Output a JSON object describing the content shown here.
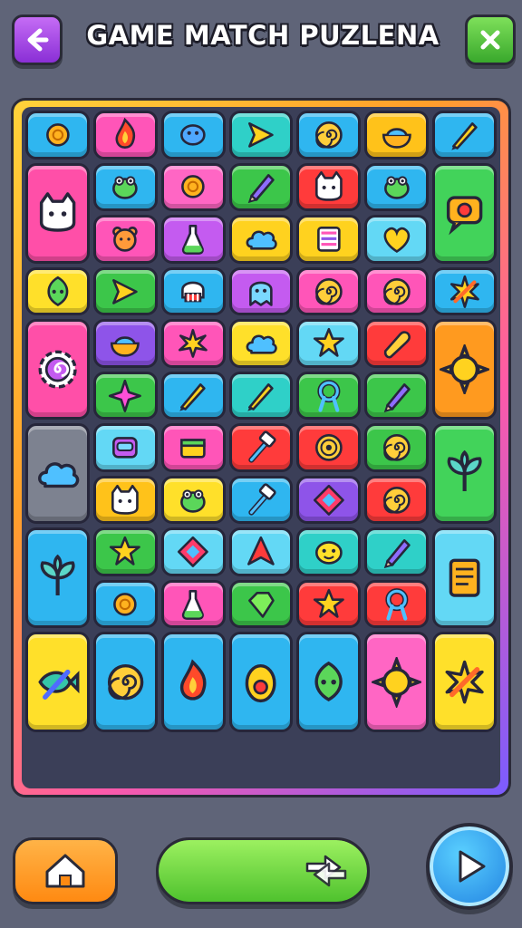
{
  "header": {
    "title": "GAME MATCH PUZLENA",
    "back_icon": "arrow-left-icon",
    "close_icon": "close-x-icon"
  },
  "board": {
    "columns": 7,
    "rows": 13,
    "tiles": [
      {
        "icon": "sun-blob",
        "color": "#2fb6f0",
        "row": 0,
        "col": 0,
        "rowspan": 1,
        "colspan": 1
      },
      {
        "icon": "flame",
        "color": "#ff55b8",
        "row": 0,
        "col": 1,
        "rowspan": 1,
        "colspan": 1
      },
      {
        "icon": "bird",
        "color": "#2fb6f0",
        "row": 0,
        "col": 2,
        "rowspan": 1,
        "colspan": 1
      },
      {
        "icon": "arrow",
        "color": "#2fd0c8",
        "row": 0,
        "col": 3,
        "rowspan": 1,
        "colspan": 1
      },
      {
        "icon": "spiral",
        "color": "#2fb6f0",
        "row": 0,
        "col": 4,
        "rowspan": 1,
        "colspan": 1
      },
      {
        "icon": "bowl",
        "color": "#ffc21a",
        "row": 0,
        "col": 5,
        "rowspan": 1,
        "colspan": 1
      },
      {
        "icon": "pen-star",
        "color": "#2fb6f0",
        "row": 0,
        "col": 6,
        "rowspan": 1,
        "colspan": 1
      },
      {
        "icon": "cat-face",
        "color": "#ff4fa8",
        "row": 1,
        "col": 0,
        "rowspan": 2,
        "colspan": 1
      },
      {
        "icon": "frog",
        "color": "#2fb6f0",
        "row": 1,
        "col": 1,
        "rowspan": 1,
        "colspan": 1
      },
      {
        "icon": "sun-blob",
        "color": "#ff66c4",
        "row": 1,
        "col": 2,
        "rowspan": 1,
        "colspan": 1
      },
      {
        "icon": "pencil",
        "color": "#3cc64a",
        "row": 1,
        "col": 3,
        "rowspan": 1,
        "colspan": 1
      },
      {
        "icon": "cat-face",
        "color": "#ff3b3b",
        "row": 1,
        "col": 4,
        "rowspan": 1,
        "colspan": 1
      },
      {
        "icon": "frog",
        "color": "#2fb6f0",
        "row": 1,
        "col": 5,
        "rowspan": 1,
        "colspan": 1
      },
      {
        "icon": "chat-target",
        "color": "#42d35a",
        "row": 1,
        "col": 6,
        "rowspan": 2,
        "colspan": 1
      },
      {
        "icon": "bear",
        "color": "#ff55b8",
        "row": 2,
        "col": 1,
        "rowspan": 1,
        "colspan": 1
      },
      {
        "icon": "potion",
        "color": "#c45bf0",
        "row": 2,
        "col": 2,
        "rowspan": 1,
        "colspan": 1
      },
      {
        "icon": "cloud",
        "color": "#ffd21f",
        "row": 2,
        "col": 3,
        "rowspan": 1,
        "colspan": 1
      },
      {
        "icon": "stripes",
        "color": "#ffd21f",
        "row": 2,
        "col": 4,
        "rowspan": 1,
        "colspan": 1
      },
      {
        "icon": "heart-blob",
        "color": "#63d8f5",
        "row": 2,
        "col": 5,
        "rowspan": 1,
        "colspan": 1
      },
      {
        "icon": "leaf-face",
        "color": "#ffe02a",
        "row": 3,
        "col": 0,
        "rowspan": 1,
        "colspan": 1
      },
      {
        "icon": "arrow",
        "color": "#3cc64a",
        "row": 3,
        "col": 1,
        "rowspan": 1,
        "colspan": 1
      },
      {
        "icon": "skull",
        "color": "#2fb6f0",
        "row": 3,
        "col": 2,
        "rowspan": 1,
        "colspan": 1
      },
      {
        "icon": "ghost",
        "color": "#c45bf0",
        "row": 3,
        "col": 3,
        "rowspan": 1,
        "colspan": 1
      },
      {
        "icon": "spiral",
        "color": "#ff55b8",
        "row": 3,
        "col": 4,
        "rowspan": 1,
        "colspan": 1
      },
      {
        "icon": "spiral",
        "color": "#ff55b8",
        "row": 3,
        "col": 5,
        "rowspan": 1,
        "colspan": 1
      },
      {
        "icon": "pencil-burst",
        "color": "#2fb6f0",
        "row": 3,
        "col": 6,
        "rowspan": 1,
        "colspan": 1
      },
      {
        "icon": "gear-spiral",
        "color": "#ff4fa8",
        "row": 4,
        "col": 0,
        "rowspan": 2,
        "colspan": 1
      },
      {
        "icon": "bowl",
        "color": "#8e54e9",
        "row": 4,
        "col": 1,
        "rowspan": 1,
        "colspan": 1
      },
      {
        "icon": "star-burst",
        "color": "#ff55b8",
        "row": 4,
        "col": 2,
        "rowspan": 1,
        "colspan": 1
      },
      {
        "icon": "cloud",
        "color": "#ffe02a",
        "row": 4,
        "col": 3,
        "rowspan": 1,
        "colspan": 1
      },
      {
        "icon": "star",
        "color": "#63d8f5",
        "row": 4,
        "col": 4,
        "rowspan": 1,
        "colspan": 1
      },
      {
        "icon": "bottle",
        "color": "#ff3b3b",
        "row": 4,
        "col": 5,
        "rowspan": 1,
        "colspan": 1
      },
      {
        "icon": "sun",
        "color": "#ff9a1f",
        "row": 4,
        "col": 6,
        "rowspan": 2,
        "colspan": 1
      },
      {
        "icon": "sparkle",
        "color": "#3cc64a",
        "row": 5,
        "col": 1,
        "rowspan": 1,
        "colspan": 1
      },
      {
        "icon": "pen-star",
        "color": "#2fb6f0",
        "row": 5,
        "col": 2,
        "rowspan": 1,
        "colspan": 1
      },
      {
        "icon": "pen-star",
        "color": "#2fd0c8",
        "row": 5,
        "col": 3,
        "rowspan": 1,
        "colspan": 1
      },
      {
        "icon": "ribbon",
        "color": "#3cc64a",
        "row": 5,
        "col": 4,
        "rowspan": 1,
        "colspan": 1
      },
      {
        "icon": "pencil",
        "color": "#3cc64a",
        "row": 5,
        "col": 5,
        "rowspan": 1,
        "colspan": 1
      },
      {
        "icon": "cloud",
        "color": "#7d8290",
        "row": 6,
        "col": 0,
        "rowspan": 2,
        "colspan": 1
      },
      {
        "icon": "robot",
        "color": "#63d8f5",
        "row": 6,
        "col": 1,
        "rowspan": 1,
        "colspan": 1
      },
      {
        "icon": "box",
        "color": "#ff55b8",
        "row": 6,
        "col": 2,
        "rowspan": 1,
        "colspan": 1
      },
      {
        "icon": "hammer",
        "color": "#ff3b3b",
        "row": 6,
        "col": 3,
        "rowspan": 1,
        "colspan": 1
      },
      {
        "icon": "target",
        "color": "#ff3b3b",
        "row": 6,
        "col": 4,
        "rowspan": 1,
        "colspan": 1
      },
      {
        "icon": "spiral",
        "color": "#3cc64a",
        "row": 6,
        "col": 5,
        "rowspan": 1,
        "colspan": 1
      },
      {
        "icon": "leaf-plant",
        "color": "#42d35a",
        "row": 6,
        "col": 6,
        "rowspan": 2,
        "colspan": 1
      },
      {
        "icon": "cat-face",
        "color": "#ffc21a",
        "row": 7,
        "col": 1,
        "rowspan": 1,
        "colspan": 1
      },
      {
        "icon": "frog",
        "color": "#ffe02a",
        "row": 7,
        "col": 2,
        "rowspan": 1,
        "colspan": 1
      },
      {
        "icon": "hammer",
        "color": "#2fb6f0",
        "row": 7,
        "col": 3,
        "rowspan": 1,
        "colspan": 1
      },
      {
        "icon": "diamond",
        "color": "#8e54e9",
        "row": 7,
        "col": 4,
        "rowspan": 1,
        "colspan": 1
      },
      {
        "icon": "spiral",
        "color": "#ff3b3b",
        "row": 7,
        "col": 5,
        "rowspan": 1,
        "colspan": 1
      },
      {
        "icon": "leaf-plant",
        "color": "#2fb6f0",
        "row": 8,
        "col": 0,
        "rowspan": 2,
        "colspan": 1
      },
      {
        "icon": "star",
        "color": "#3cc64a",
        "row": 8,
        "col": 1,
        "rowspan": 1,
        "colspan": 1
      },
      {
        "icon": "diamond",
        "color": "#63d8f5",
        "row": 8,
        "col": 2,
        "rowspan": 1,
        "colspan": 1
      },
      {
        "icon": "arrow-up",
        "color": "#63d8f5",
        "row": 8,
        "col": 3,
        "rowspan": 1,
        "colspan": 1
      },
      {
        "icon": "face",
        "color": "#2fd0c8",
        "row": 8,
        "col": 4,
        "rowspan": 1,
        "colspan": 1
      },
      {
        "icon": "pencil",
        "color": "#2fd0c8",
        "row": 8,
        "col": 5,
        "rowspan": 1,
        "colspan": 1
      },
      {
        "icon": "note",
        "color": "#63d8f5",
        "row": 8,
        "col": 6,
        "rowspan": 2,
        "colspan": 1
      },
      {
        "icon": "sun-blob",
        "color": "#2fb6f0",
        "row": 9,
        "col": 1,
        "rowspan": 1,
        "colspan": 1
      },
      {
        "icon": "potion",
        "color": "#ff55b8",
        "row": 9,
        "col": 2,
        "rowspan": 1,
        "colspan": 1
      },
      {
        "icon": "gem",
        "color": "#3cc64a",
        "row": 9,
        "col": 3,
        "rowspan": 1,
        "colspan": 1
      },
      {
        "icon": "star",
        "color": "#ff3b3b",
        "row": 9,
        "col": 4,
        "rowspan": 1,
        "colspan": 1
      },
      {
        "icon": "ribbon",
        "color": "#ff3b3b",
        "row": 9,
        "col": 5,
        "rowspan": 1,
        "colspan": 1
      },
      {
        "icon": "fish-pen",
        "color": "#ffe02a",
        "row": 10,
        "col": 0,
        "rowspan": 2,
        "colspan": 1
      },
      {
        "icon": "spiral",
        "color": "#2fb6f0",
        "row": 10,
        "col": 1,
        "rowspan": 2,
        "colspan": 1
      },
      {
        "icon": "flame",
        "color": "#2fb6f0",
        "row": 10,
        "col": 2,
        "rowspan": 2,
        "colspan": 1
      },
      {
        "icon": "egg",
        "color": "#2fb6f0",
        "row": 10,
        "col": 3,
        "rowspan": 2,
        "colspan": 1
      },
      {
        "icon": "leaf-face",
        "color": "#2fb6f0",
        "row": 10,
        "col": 4,
        "rowspan": 2,
        "colspan": 1
      },
      {
        "icon": "sun",
        "color": "#ff66c4",
        "row": 10,
        "col": 5,
        "rowspan": 2,
        "colspan": 1
      },
      {
        "icon": "pencil-burst",
        "color": "#ffe02a",
        "row": 10,
        "col": 6,
        "rowspan": 2,
        "colspan": 1
      }
    ]
  },
  "footer": {
    "home_icon": "house-icon",
    "progress_fraction": 1.0,
    "progress_icon": "shuffle-arrows-icon",
    "play_icon": "play-triangle-icon"
  }
}
